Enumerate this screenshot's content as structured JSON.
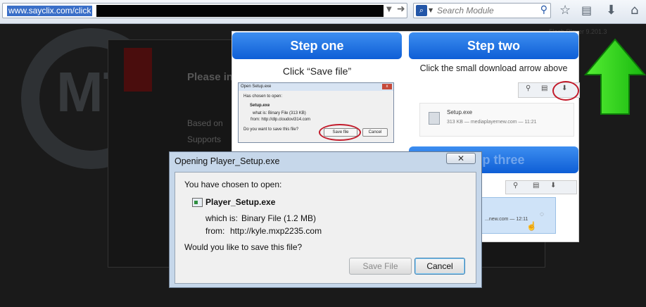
{
  "browser": {
    "url": "www.sayclix.com/click",
    "search_placeholder": "Search Module",
    "icons": [
      "dropdown-icon",
      "go-arrow-icon",
      "search-engine-icon",
      "magnifier-icon",
      "bookmark-star-icon",
      "bookmarks-list-icon",
      "download-icon",
      "home-icon"
    ]
  },
  "background_page": {
    "watermark": "MT",
    "heading": "Please in",
    "bullets": [
      "Based on",
      "Supports"
    ],
    "top_right_text": "Flash Player 9.201.3"
  },
  "instructions": {
    "step_one": {
      "title": "Step one",
      "desc": "Click “Save file”",
      "mini_dialog": {
        "title": "Open Setup.exe",
        "line1": "Has chosen to open:",
        "file": "Setup.exe",
        "what": "what is:  Binary File (313 KB)",
        "from": "from:  http://dlp.cloudovi314.com",
        "question": "Do you want to save this file?",
        "save": "Save file",
        "cancel": "Cancel"
      }
    },
    "step_two": {
      "title": "Step two",
      "desc": "Click the small download arrow above",
      "download_name": "Setup.exe",
      "download_info": "313 KB — mediaplayernew.com — 11:21"
    },
    "step_three": {
      "title": "Step three",
      "download_info": "...new.com — 12:11"
    }
  },
  "dialog": {
    "title": "Opening Player_Setup.exe",
    "close_label": "✕",
    "chosen_text": "You have chosen to open:",
    "file_name": "Player_Setup.exe",
    "which_label": "which is:",
    "which_value": "Binary File (1.2 MB)",
    "from_label": "from:",
    "from_value": "http://kyle.mxp2235.com",
    "question": "Would you like to save this file?",
    "save_button": "Save File",
    "cancel_button": "Cancel"
  },
  "colors": {
    "step_bar": "#1a6fe0",
    "arrow": "#22cc11",
    "url_highlight": "#3a6fc8"
  }
}
